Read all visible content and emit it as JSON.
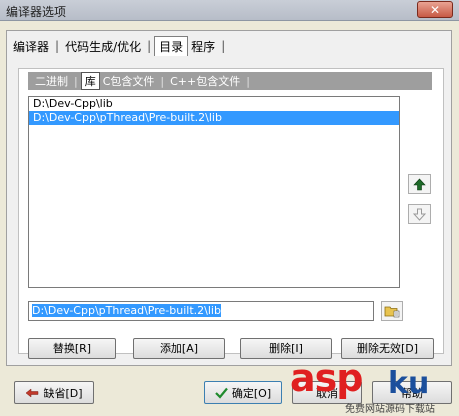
{
  "window": {
    "title": "编译器选项",
    "close_label": "✕"
  },
  "main_tabs": [
    {
      "label": "编译器"
    },
    {
      "label": "代码生成/优化"
    },
    {
      "label": "目录",
      "active": true
    },
    {
      "label": "程序"
    }
  ],
  "sub_tabs": [
    {
      "label": "二进制"
    },
    {
      "label": "库",
      "active": true
    },
    {
      "label": "C包含文件"
    },
    {
      "label": "C++包含文件"
    }
  ],
  "directories": [
    {
      "path": "D:\\Dev-Cpp\\lib"
    },
    {
      "path": "D:\\Dev-Cpp\\pThread\\Pre-built.2\\lib",
      "selected": true
    }
  ],
  "path_field": {
    "value": "D:\\Dev-Cpp\\pThread\\Pre-built.2\\lib"
  },
  "actions": {
    "replace": "替换[R]",
    "add": "添加[A]",
    "delete": "删除[I]",
    "delete_invalid": "删除无效[D]"
  },
  "footer": {
    "default": "缺省[D]",
    "ok": "确定[O]",
    "cancel": "取消",
    "help": "帮助"
  },
  "icons": {
    "up": "arrow-up-icon",
    "down": "arrow-down-icon",
    "browse": "folder-browse-icon",
    "default": "arrow-left-icon",
    "ok": "checkmark-icon"
  },
  "colors": {
    "selection": "#3399ff",
    "up_arrow": "#1f6b2a",
    "default_arrow": "#c0392b"
  },
  "watermark": {
    "brand_a": "asp",
    "brand_b": "ku",
    "sub": "免费网站源码下载站"
  }
}
